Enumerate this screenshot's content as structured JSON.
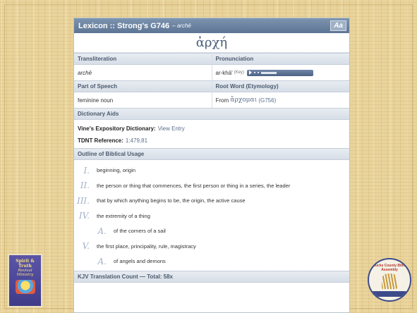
{
  "lexicon": {
    "title": "Lexicon :: Strong's G746",
    "title_sub": "– archē",
    "font_button": "Aa",
    "greek_word": "ἀρχή"
  },
  "fields": {
    "transliteration_label": "Transliteration",
    "transliteration_value": "archē",
    "pronunciation_label": "Pronunciation",
    "pronunciation_value": "ar-khā'",
    "pronunciation_key": "(Key)",
    "part_of_speech_label": "Part of Speech",
    "part_of_speech_value": "feminine noun",
    "root_word_label": "Root Word (Etymology)",
    "root_from": "From",
    "root_greek": "ἄρχομαι",
    "root_ref": "(G756)"
  },
  "aids": {
    "label": "Dictionary Aids",
    "vines_label": "Vine's Expository Dictionary:",
    "vines_link": "View Entry",
    "tdnt_label": "TDNT Reference:",
    "tdnt_value": "1:479,81"
  },
  "outline": {
    "label": "Outline of Biblical Usage",
    "items": [
      {
        "num": "I.",
        "text": "beginning, origin"
      },
      {
        "num": "II.",
        "text": "the person or thing that commences, the first person or thing in a series, the leader"
      },
      {
        "num": "III.",
        "text": "that by which anything begins to be, the origin, the active cause"
      },
      {
        "num": "IV.",
        "text": "the extremity of a thing"
      },
      {
        "num": "A.",
        "text": "of the corners of a sail"
      },
      {
        "num": "V.",
        "text": "the first place, principality, rule, magistracy"
      },
      {
        "num": "A.",
        "text": "of angels and demons"
      }
    ]
  },
  "kjv": {
    "label": "KJV Translation Count — Total: 58x"
  },
  "logos": {
    "left_line1": "Spirit & Truth",
    "left_line2": "Revival Ministry",
    "right_top": "Bucks County Bible Assembly"
  }
}
